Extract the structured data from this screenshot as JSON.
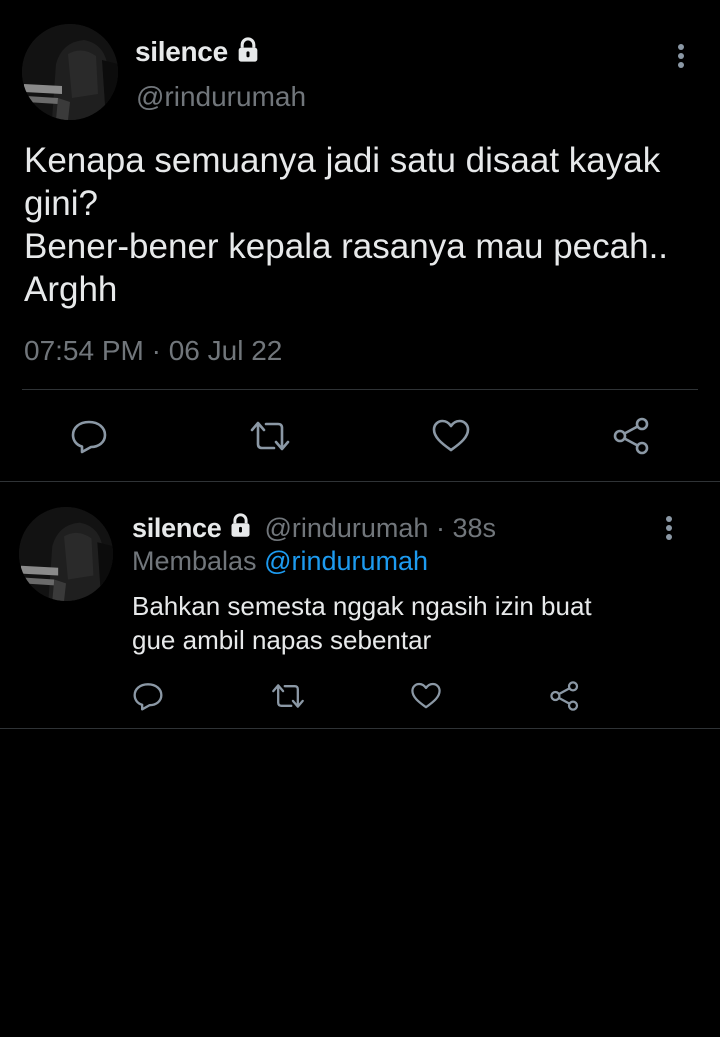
{
  "colors": {
    "background": "#000000",
    "primary_text": "#e7e9ea",
    "secondary_text": "#71767b",
    "accent": "#1d9bf0",
    "divider": "#2f3336",
    "icon": "#8b98a5"
  },
  "main_tweet": {
    "display_name": "silence",
    "handle": "@rindurumah",
    "text_lines": [
      "Kenapa semuanya jadi satu disaat kayak",
      "gini?",
      "Bener-bener kepala rasanya mau pecah..",
      "Arghh"
    ],
    "timestamp": "07:54 PM · 06 Jul 22",
    "icons": {
      "lock": "lock-icon",
      "more": "more-vertical-icon",
      "reply": "reply-icon",
      "retweet": "retweet-icon",
      "like": "heart-icon",
      "share": "share-icon"
    }
  },
  "reply_tweet": {
    "display_name": "silence",
    "handle_time": "@rindurumah · 38s",
    "replying_to_label": "Membalas",
    "replying_to_handle": "@rindurumah",
    "text_lines": [
      "Bahkan semesta nggak ngasih izin buat",
      "gue ambil napas sebentar"
    ]
  }
}
